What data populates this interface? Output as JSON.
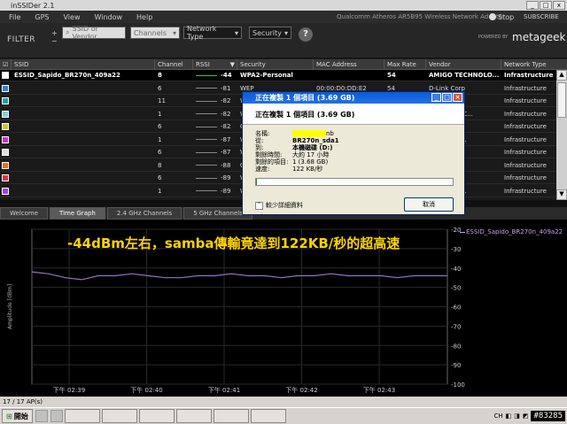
{
  "window": {
    "title": "inSSIDer 2.1",
    "adapter": "Qualcomm Atheros AR5B95 Wireless Network Adapter",
    "stop_label": "Stop",
    "subscribe_label": "SUBSCRIBE",
    "min": "_",
    "max": "□",
    "close": "x"
  },
  "menu": [
    "File",
    "GPS",
    "View",
    "Window",
    "Help"
  ],
  "filter": {
    "label": "FILTER",
    "add_symbol": "+",
    "remove_symbol": "−",
    "search_placeholder": "SSID or Vendor",
    "channels": "Channels",
    "network_type": "Network Type",
    "security": "Security",
    "help": "?",
    "powered_by": "POWERED BY",
    "brand": "metageek"
  },
  "table": {
    "headers": [
      "",
      "SSID",
      "Channel",
      "RSSI",
      "Security",
      "MAC Address",
      "Max Rate",
      "Vendor",
      "Network Type"
    ],
    "rows": [
      {
        "color": "#ffffff",
        "ssid": "ESSID_Sapido_BR270n_409a22",
        "channel": "8",
        "rssi": "-44",
        "security": "WPA2-Personal",
        "mac": "",
        "rate": "54",
        "vendor": "AMIGO TECHNOLO...",
        "type": "Infrastructure",
        "selected": true
      },
      {
        "color": "#2f7fd6",
        "ssid": "",
        "channel": "6",
        "rssi": "-81",
        "security": "WEP",
        "mac": "00:00:D0:DD:E2",
        "rate": "54",
        "vendor": "D-Link Corp",
        "type": "Infrastructure"
      },
      {
        "color": "#20a0a0",
        "ssid": "",
        "channel": "11",
        "rssi": "-82",
        "security": "WPA",
        "mac": "",
        "rate": "",
        "vendor": "on",
        "type": "Infrastructure"
      },
      {
        "color": "#7fd0e8",
        "ssid": "",
        "channel": "1",
        "rssi": "-82",
        "security": "WPA",
        "mac": "",
        "rate": "",
        "vendor": "unications C...",
        "type": "Infrastructure"
      },
      {
        "color": "#c8c82a",
        "ssid": "",
        "channel": "6",
        "rssi": "-82",
        "security": "Op",
        "mac": "",
        "rate": "",
        "vendor": "MPUTER I...",
        "type": "Infrastructure"
      },
      {
        "color": "#d02ad0",
        "ssid": "",
        "channel": "1",
        "rssi": "-87",
        "security": "WE",
        "mac": "",
        "rate": "",
        "vendor": "unications...",
        "type": "Infrastructure"
      },
      {
        "color": "#e0e0e0",
        "ssid": "",
        "channel": "6",
        "rssi": "-87",
        "security": "WP",
        "mac": "",
        "rate": "",
        "vendor": "",
        "type": "Infrastructure"
      },
      {
        "color": "#e07020",
        "ssid": "",
        "channel": "8",
        "rssi": "-88",
        "security": "O",
        "mac": "",
        "rate": "",
        "vendor": "Inc",
        "type": "Infrastructure"
      },
      {
        "color": "#e03050",
        "ssid": "",
        "channel": "6",
        "rssi": "-89",
        "security": "W",
        "mac": "",
        "rate": "",
        "vendor": "Inc",
        "type": "Infrastructure"
      },
      {
        "color": "#a040e0",
        "ssid": "",
        "channel": "1",
        "rssi": "-89",
        "security": "W",
        "mac": "",
        "rate": "",
        "vendor": "unications...",
        "type": "Infrastructure"
      }
    ]
  },
  "tabs": [
    "Welcome",
    "Time Graph",
    "2.4 GHz Channels",
    "5 GHz Channels"
  ],
  "graph": {
    "overlay_text": "-44dBm左右，samba傳輸竟達到122KB/秒的超高速",
    "legend": "ESSID_Sapido_BR270n_409a22",
    "ylabel": "Amplitude [dBm]",
    "yticks": [
      -20,
      -30,
      -40,
      -50,
      -60,
      -70,
      -80,
      -90,
      -100
    ],
    "xticks": [
      "下午 02:39",
      "下午 02:40",
      "下午 02:41",
      "下午 02:42",
      "下午 02:43"
    ],
    "line_color": "#9a6fc8"
  },
  "status": "17 / 17 AP(s)",
  "dialog": {
    "title": "正在複製 1 個項目 (3.69 GB)",
    "header": "正在複製 1 個項目 (3.69 GB)",
    "name_label": "名稱:",
    "name_suffix": "nb",
    "from_label": "從:",
    "from_value": "BR270n_sda1",
    "to_label": "到:",
    "to_value": "本機磁碟 (D:)",
    "remaining_label": "剩餘時間:",
    "remaining_value": "大約 17 小時",
    "items_label": "剩餘的項目:",
    "items_value": "1 (3.68 GB)",
    "speed_label": "速度:",
    "speed_value": "122 KB/秒",
    "progress": 0.003,
    "more_info": "較少詳細資料",
    "cancel": "取消"
  },
  "taskbar": {
    "start": "開始",
    "lang": "CH",
    "watermark": "#83285"
  }
}
